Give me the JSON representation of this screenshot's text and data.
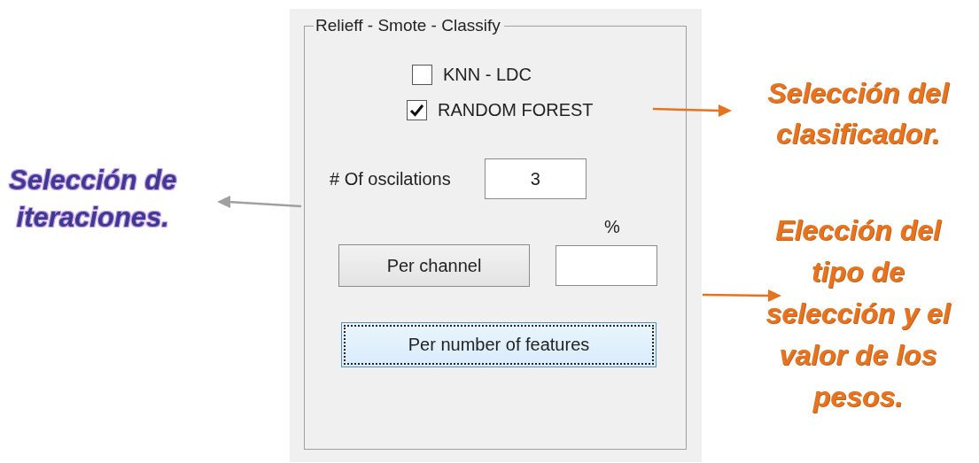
{
  "panel": {
    "group_title": "Relieff - Smote - Classify",
    "classifiers": [
      {
        "label": "KNN - LDC",
        "checked": false
      },
      {
        "label": "RANDOM FOREST",
        "checked": true
      }
    ],
    "oscillations": {
      "label": "# Of oscilations",
      "value": "3"
    },
    "percent": {
      "label": "%"
    },
    "buttons": [
      {
        "label": "Per channel",
        "focused": false
      },
      {
        "label": "Per number of features",
        "focused": true
      }
    ]
  },
  "annotations": [
    {
      "lines": [
        "Selección de",
        "iteraciones."
      ],
      "color": "#3d3b8e"
    },
    {
      "lines": [
        "Selección del",
        "clasificador."
      ],
      "color": "#e8731e"
    },
    {
      "lines": [
        "Elección del",
        "tipo de",
        "selección y el",
        "valor de los",
        "pesos."
      ],
      "color": "#e8731e"
    }
  ]
}
